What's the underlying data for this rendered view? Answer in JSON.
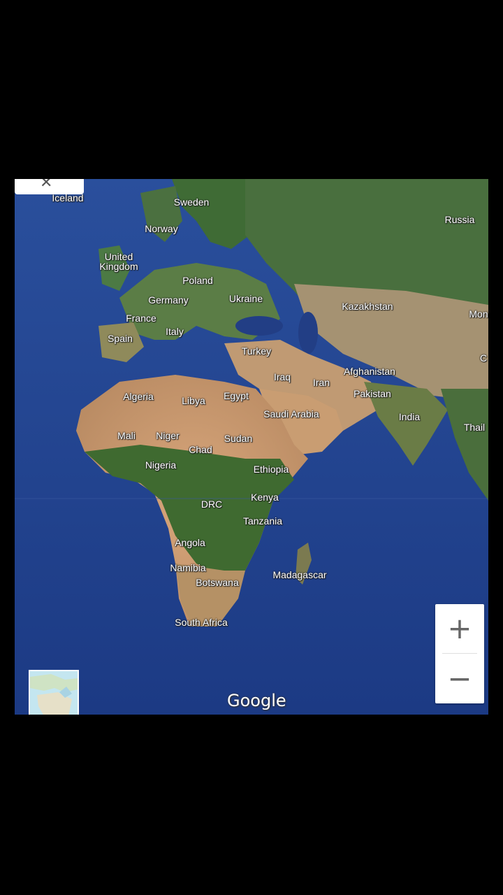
{
  "map": {
    "labels": [
      {
        "text": "Iceland"
      },
      {
        "text": "Sweden"
      },
      {
        "text": "Norway"
      },
      {
        "text": "United\nKingdom"
      },
      {
        "text": "Poland"
      },
      {
        "text": "Germany"
      },
      {
        "text": "Ukraine"
      },
      {
        "text": "France"
      },
      {
        "text": "Italy"
      },
      {
        "text": "Spain"
      },
      {
        "text": "Turkey"
      },
      {
        "text": "Russia"
      },
      {
        "text": "Kazakhstan"
      },
      {
        "text": "Mon"
      },
      {
        "text": "Afghanistan"
      },
      {
        "text": "Iraq"
      },
      {
        "text": "Iran"
      },
      {
        "text": "Pakistan"
      },
      {
        "text": "Algeria"
      },
      {
        "text": "Libya"
      },
      {
        "text": "Egypt"
      },
      {
        "text": "Saudi Arabia"
      },
      {
        "text": "India"
      },
      {
        "text": "Thail"
      },
      {
        "text": "C"
      },
      {
        "text": "Mali"
      },
      {
        "text": "Niger"
      },
      {
        "text": "Chad"
      },
      {
        "text": "Sudan"
      },
      {
        "text": "Nigeria"
      },
      {
        "text": "Ethiopia"
      },
      {
        "text": "DRC"
      },
      {
        "text": "Kenya"
      },
      {
        "text": "Tanzania"
      },
      {
        "text": "Angola"
      },
      {
        "text": "Namibia"
      },
      {
        "text": "Botswana"
      },
      {
        "text": "Madagascar"
      },
      {
        "text": "South Africa"
      }
    ],
    "attribution": "Google",
    "zoom_in_label": "+",
    "zoom_out_label": "−",
    "close_label": "✕"
  }
}
